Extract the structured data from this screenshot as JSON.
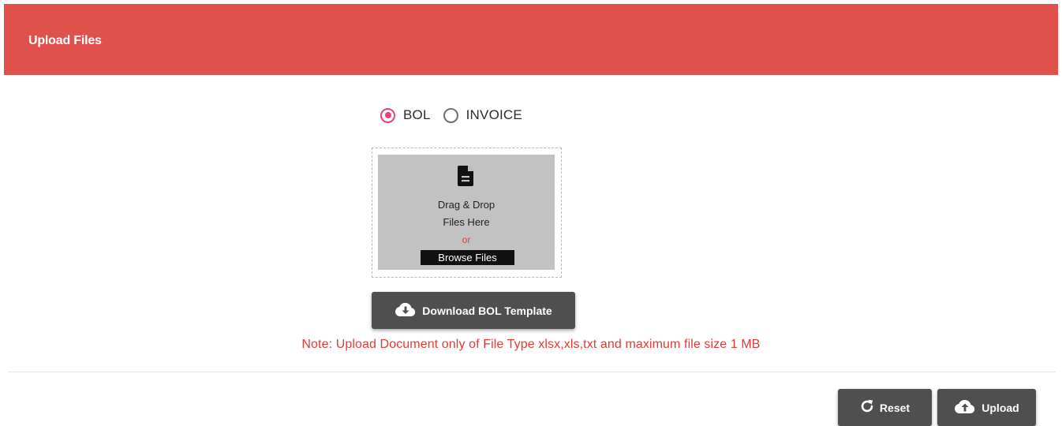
{
  "header": {
    "title": "Upload Files",
    "color": "#e0514c"
  },
  "document_type": {
    "options": [
      {
        "label": "BOL",
        "selected": true
      },
      {
        "label": "INVOICE",
        "selected": false
      }
    ],
    "accent_color": "#e8417a"
  },
  "dropzone": {
    "icon": "file-document-icon",
    "line1": "Drag & Drop",
    "line2": "Files Here",
    "or_text": "or",
    "browse_label": "Browse Files"
  },
  "actions": {
    "download_template_label": "Download BOL Template",
    "download_icon": "cloud-download-icon",
    "reset_label": "Reset",
    "reset_icon": "refresh-icon",
    "upload_label": "Upload",
    "upload_icon": "cloud-upload-icon"
  },
  "note": "Note: Upload Document only of File Type xlsx,xls,txt and maximum file size 1 MB",
  "note_color": "#e53935"
}
